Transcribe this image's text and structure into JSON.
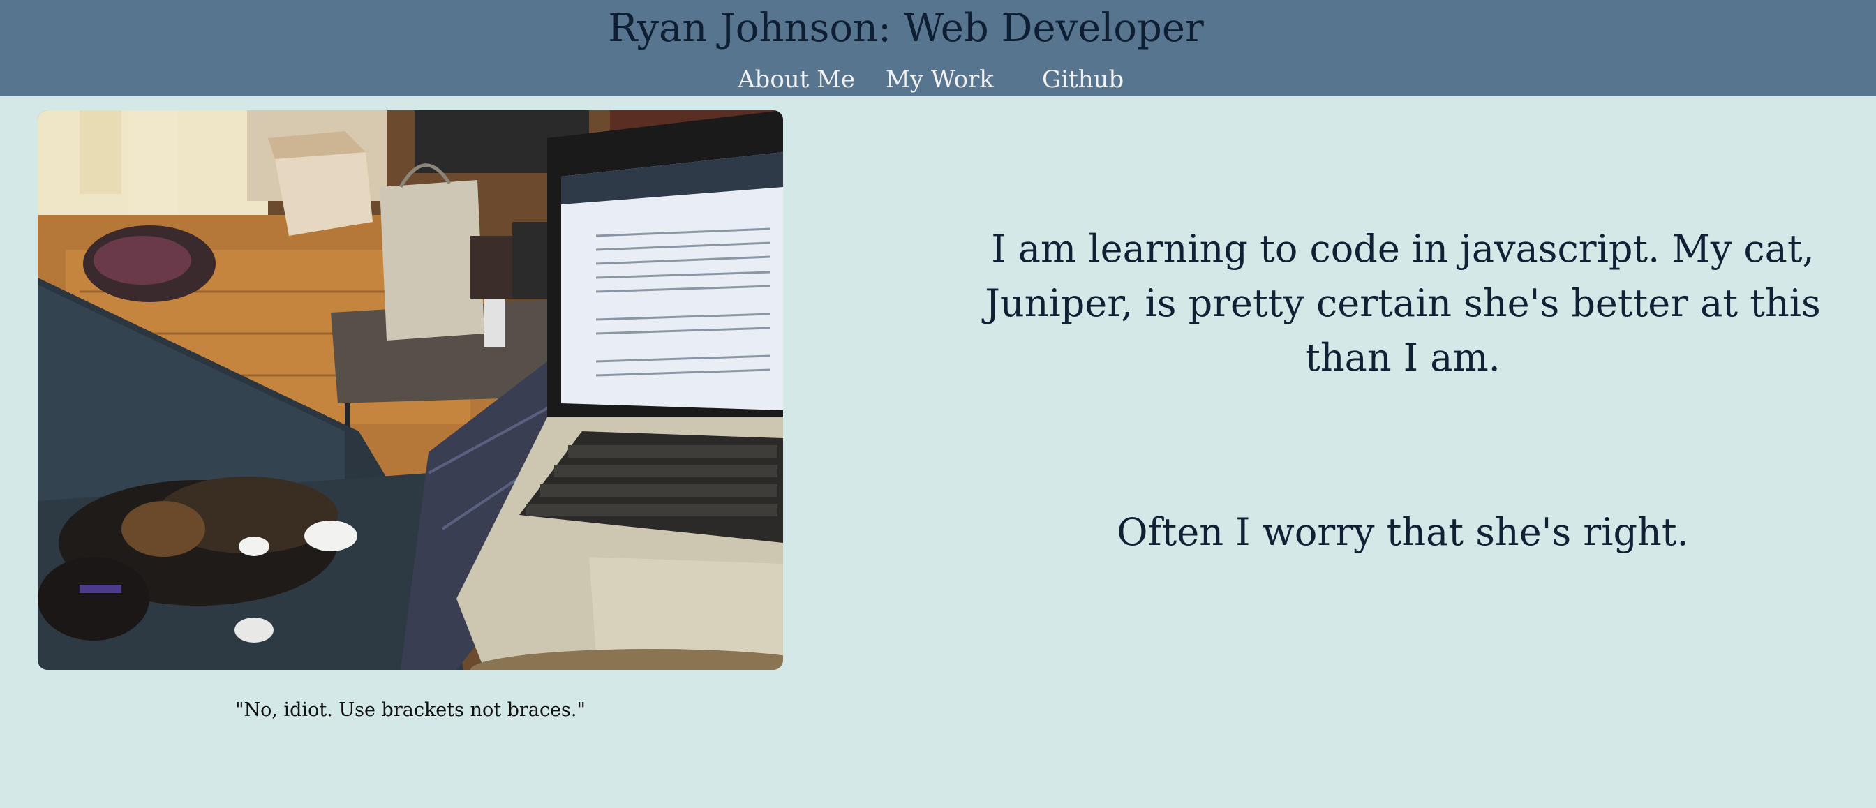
{
  "header": {
    "title": "Ryan Johnson: Web Developer",
    "nav": [
      {
        "label": "About Me"
      },
      {
        "label": "My Work"
      },
      {
        "label": "Github"
      }
    ]
  },
  "main": {
    "photo": {
      "icon": "photo-cat-laptop"
    },
    "caption": "\"No, idiot. Use brackets not braces.\"",
    "intro": "I am learning to code in javascript. My cat, Juniper, is pretty certain she's better at this than I am.",
    "worry": "Often I worry that she's right."
  },
  "colors": {
    "header_bg": "#58758f",
    "page_bg": "#d4e8e8",
    "title_text": "#0e1f33",
    "nav_text": "#f2f2f2",
    "body_text": "#122035"
  }
}
